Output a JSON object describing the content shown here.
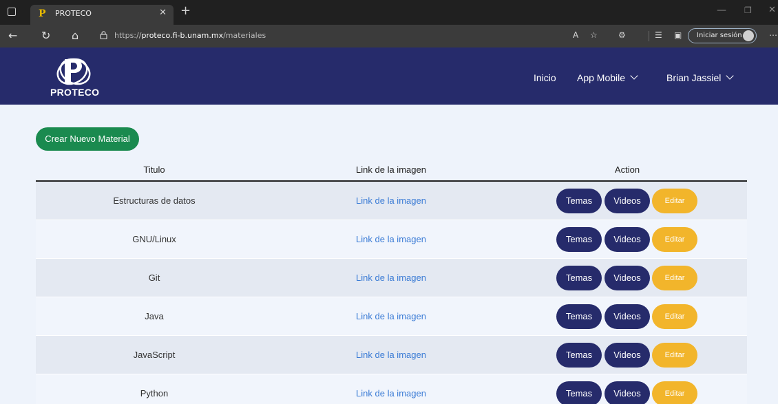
{
  "browser": {
    "tab_title": "PROTECO",
    "tab_favicon": "P",
    "url_prefix": "https://",
    "url_domain": "proteco.fi-b.unam.mx",
    "url_path": "/materiales",
    "signin_label": "Iniciar sesión"
  },
  "navbar": {
    "logo_text": "PROTECO",
    "links": [
      {
        "label": "Inicio"
      },
      {
        "label": "App Mobile"
      },
      {
        "label": "Brian Jassiel"
      }
    ],
    "background": "#262b6b"
  },
  "main": {
    "create_button": "Crear Nuevo Material",
    "columns": [
      "Titulo",
      "Link de la imagen",
      "Action"
    ],
    "rows": [
      {
        "title": "Estructuras de datos",
        "link": "Link de la imagen"
      },
      {
        "title": "GNU/Linux",
        "link": "Link de la imagen"
      },
      {
        "title": "Git",
        "link": "Link de la imagen"
      },
      {
        "title": "Java",
        "link": "Link de la imagen"
      },
      {
        "title": "JavaScript",
        "link": "Link de la imagen"
      },
      {
        "title": "Python",
        "link": "Link de la imagen"
      }
    ],
    "actions": {
      "temas": "Temas",
      "videos": "Videos",
      "editar": "Editar"
    }
  },
  "colors": {
    "create_button": "#1a8a4f",
    "primary_button": "#262b6b",
    "edit_button": "#f2b52b",
    "link": "#3a7bd5"
  }
}
